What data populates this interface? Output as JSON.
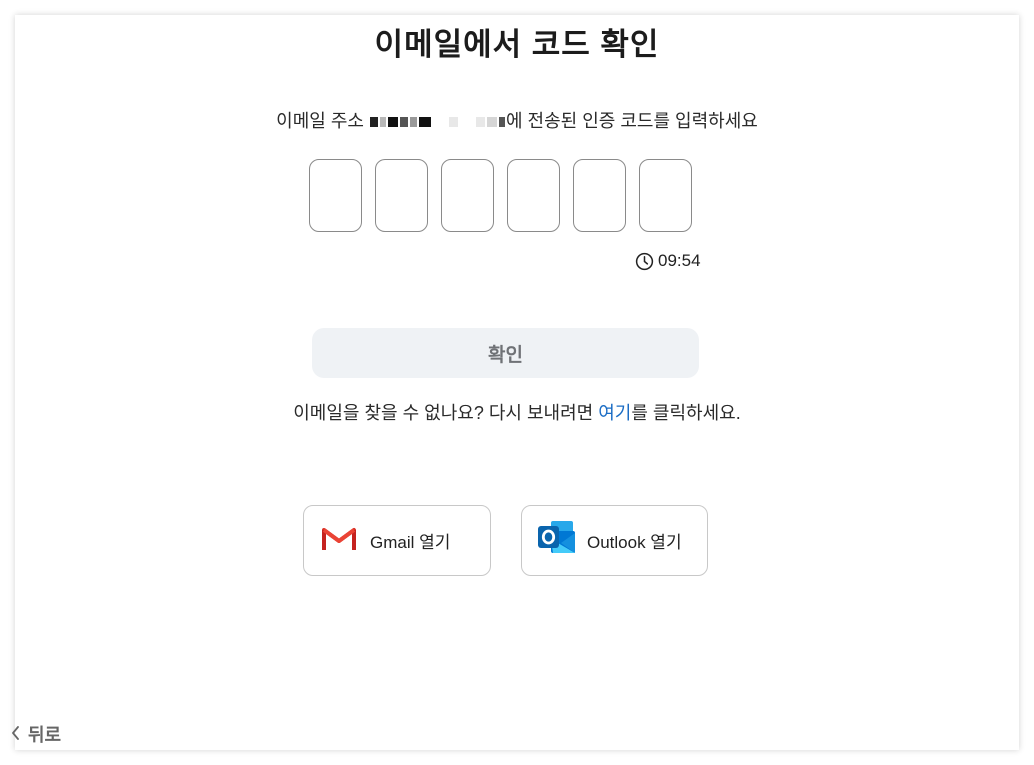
{
  "page": {
    "title": "이메일에서 코드 확인",
    "description_prefix": "이메일 주소 ",
    "description_suffix": "에 전송된 인증 코드를 입력하세요",
    "timer": "09:54",
    "confirm_label": "확인",
    "resend_prefix": "이메일을 찾을 수 없나요? 다시 보내려면 ",
    "resend_link": "여기",
    "resend_suffix": "를 클릭하세요.",
    "back_label": "뒤로"
  },
  "code_boxes": [
    "",
    "",
    "",
    "",
    "",
    ""
  ],
  "mail_buttons": {
    "gmail_label": "Gmail 열기",
    "outlook_label": "Outlook 열기"
  },
  "colors": {
    "link": "#1a6cc4",
    "confirm_bg": "#eff2f5",
    "gmail_red": "#d93025",
    "outlook_blue": "#0a64ad"
  },
  "icons": {
    "timer": "clock-icon",
    "gmail": "gmail-icon",
    "outlook": "outlook-icon",
    "back": "chevron-left-icon"
  }
}
